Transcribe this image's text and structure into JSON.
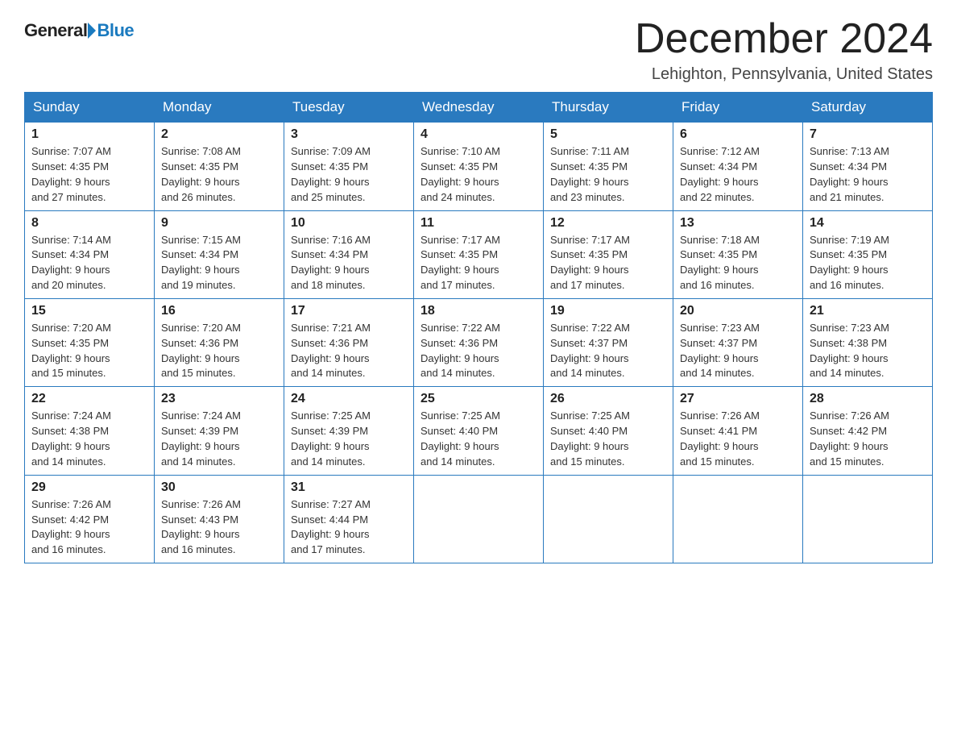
{
  "header": {
    "logo_general": "General",
    "logo_blue": "Blue",
    "month_title": "December 2024",
    "location": "Lehighton, Pennsylvania, United States"
  },
  "weekdays": [
    "Sunday",
    "Monday",
    "Tuesday",
    "Wednesday",
    "Thursday",
    "Friday",
    "Saturday"
  ],
  "weeks": [
    [
      {
        "day": "1",
        "sunrise": "7:07 AM",
        "sunset": "4:35 PM",
        "daylight": "9 hours and 27 minutes."
      },
      {
        "day": "2",
        "sunrise": "7:08 AM",
        "sunset": "4:35 PM",
        "daylight": "9 hours and 26 minutes."
      },
      {
        "day": "3",
        "sunrise": "7:09 AM",
        "sunset": "4:35 PM",
        "daylight": "9 hours and 25 minutes."
      },
      {
        "day": "4",
        "sunrise": "7:10 AM",
        "sunset": "4:35 PM",
        "daylight": "9 hours and 24 minutes."
      },
      {
        "day": "5",
        "sunrise": "7:11 AM",
        "sunset": "4:35 PM",
        "daylight": "9 hours and 23 minutes."
      },
      {
        "day": "6",
        "sunrise": "7:12 AM",
        "sunset": "4:34 PM",
        "daylight": "9 hours and 22 minutes."
      },
      {
        "day": "7",
        "sunrise": "7:13 AM",
        "sunset": "4:34 PM",
        "daylight": "9 hours and 21 minutes."
      }
    ],
    [
      {
        "day": "8",
        "sunrise": "7:14 AM",
        "sunset": "4:34 PM",
        "daylight": "9 hours and 20 minutes."
      },
      {
        "day": "9",
        "sunrise": "7:15 AM",
        "sunset": "4:34 PM",
        "daylight": "9 hours and 19 minutes."
      },
      {
        "day": "10",
        "sunrise": "7:16 AM",
        "sunset": "4:34 PM",
        "daylight": "9 hours and 18 minutes."
      },
      {
        "day": "11",
        "sunrise": "7:17 AM",
        "sunset": "4:35 PM",
        "daylight": "9 hours and 17 minutes."
      },
      {
        "day": "12",
        "sunrise": "7:17 AM",
        "sunset": "4:35 PM",
        "daylight": "9 hours and 17 minutes."
      },
      {
        "day": "13",
        "sunrise": "7:18 AM",
        "sunset": "4:35 PM",
        "daylight": "9 hours and 16 minutes."
      },
      {
        "day": "14",
        "sunrise": "7:19 AM",
        "sunset": "4:35 PM",
        "daylight": "9 hours and 16 minutes."
      }
    ],
    [
      {
        "day": "15",
        "sunrise": "7:20 AM",
        "sunset": "4:35 PM",
        "daylight": "9 hours and 15 minutes."
      },
      {
        "day": "16",
        "sunrise": "7:20 AM",
        "sunset": "4:36 PM",
        "daylight": "9 hours and 15 minutes."
      },
      {
        "day": "17",
        "sunrise": "7:21 AM",
        "sunset": "4:36 PM",
        "daylight": "9 hours and 14 minutes."
      },
      {
        "day": "18",
        "sunrise": "7:22 AM",
        "sunset": "4:36 PM",
        "daylight": "9 hours and 14 minutes."
      },
      {
        "day": "19",
        "sunrise": "7:22 AM",
        "sunset": "4:37 PM",
        "daylight": "9 hours and 14 minutes."
      },
      {
        "day": "20",
        "sunrise": "7:23 AM",
        "sunset": "4:37 PM",
        "daylight": "9 hours and 14 minutes."
      },
      {
        "day": "21",
        "sunrise": "7:23 AM",
        "sunset": "4:38 PM",
        "daylight": "9 hours and 14 minutes."
      }
    ],
    [
      {
        "day": "22",
        "sunrise": "7:24 AM",
        "sunset": "4:38 PM",
        "daylight": "9 hours and 14 minutes."
      },
      {
        "day": "23",
        "sunrise": "7:24 AM",
        "sunset": "4:39 PM",
        "daylight": "9 hours and 14 minutes."
      },
      {
        "day": "24",
        "sunrise": "7:25 AM",
        "sunset": "4:39 PM",
        "daylight": "9 hours and 14 minutes."
      },
      {
        "day": "25",
        "sunrise": "7:25 AM",
        "sunset": "4:40 PM",
        "daylight": "9 hours and 14 minutes."
      },
      {
        "day": "26",
        "sunrise": "7:25 AM",
        "sunset": "4:40 PM",
        "daylight": "9 hours and 15 minutes."
      },
      {
        "day": "27",
        "sunrise": "7:26 AM",
        "sunset": "4:41 PM",
        "daylight": "9 hours and 15 minutes."
      },
      {
        "day": "28",
        "sunrise": "7:26 AM",
        "sunset": "4:42 PM",
        "daylight": "9 hours and 15 minutes."
      }
    ],
    [
      {
        "day": "29",
        "sunrise": "7:26 AM",
        "sunset": "4:42 PM",
        "daylight": "9 hours and 16 minutes."
      },
      {
        "day": "30",
        "sunrise": "7:26 AM",
        "sunset": "4:43 PM",
        "daylight": "9 hours and 16 minutes."
      },
      {
        "day": "31",
        "sunrise": "7:27 AM",
        "sunset": "4:44 PM",
        "daylight": "9 hours and 17 minutes."
      },
      null,
      null,
      null,
      null
    ]
  ]
}
